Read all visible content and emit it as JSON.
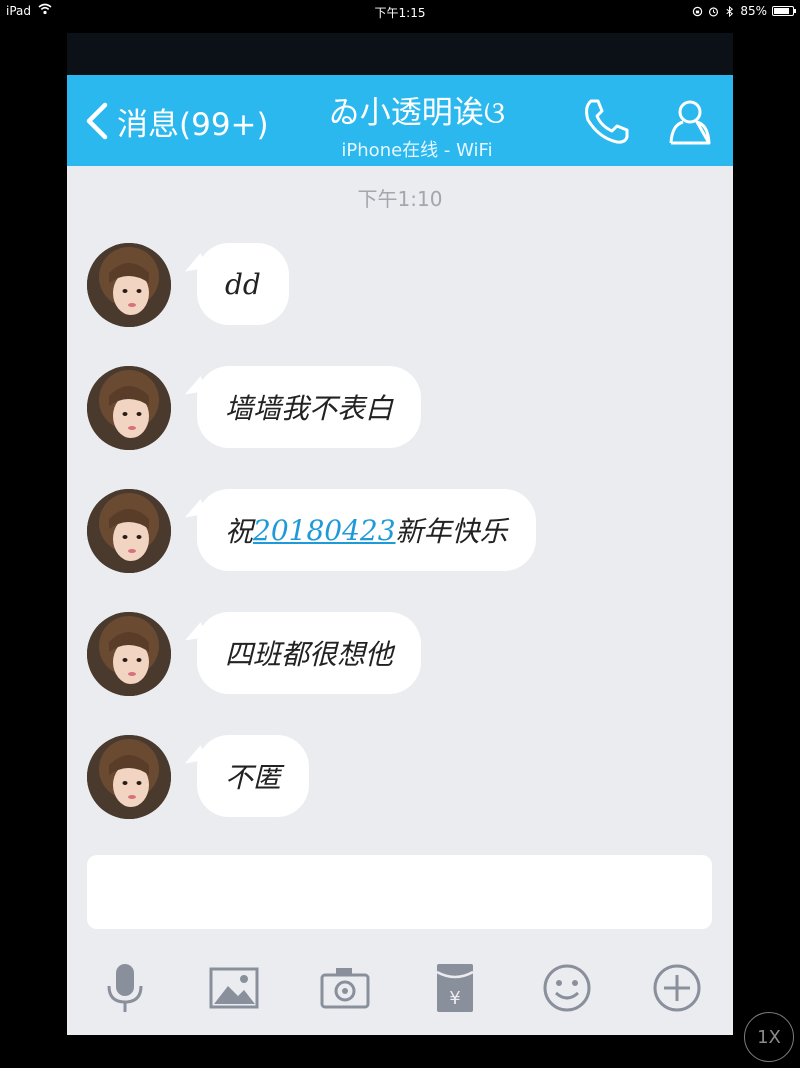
{
  "status_bar": {
    "device": "iPad",
    "time": "下午1:15",
    "battery": "85%",
    "battery_level": 0.85
  },
  "nav": {
    "back_label": "消息(99+)",
    "title": "ゐ小透明诶ଓ",
    "subtitle": "iPhone在线 - WiFi",
    "icons": [
      "chevron-left-icon",
      "phone-icon",
      "contact-icon"
    ]
  },
  "chat": {
    "timestamp": "下午1:10",
    "messages": [
      {
        "text": "dd"
      },
      {
        "text": "墙墙我不表白"
      },
      {
        "prefix": "祝",
        "link": "20180423",
        "suffix": "新年快乐"
      },
      {
        "text": "四班都很想他"
      },
      {
        "text": "不匿"
      }
    ]
  },
  "input": {
    "value": ""
  },
  "toolbar": {
    "items": [
      "microphone-icon",
      "image-icon",
      "camera-icon",
      "red-packet-icon",
      "emoji-icon",
      "plus-icon"
    ]
  },
  "zoom": {
    "label": "1X"
  },
  "colors": {
    "nav_bg": "#2bb8ef",
    "chat_bg": "#ebecf0",
    "link": "#1f9ad8",
    "icon_gray": "#8a8f9c"
  }
}
